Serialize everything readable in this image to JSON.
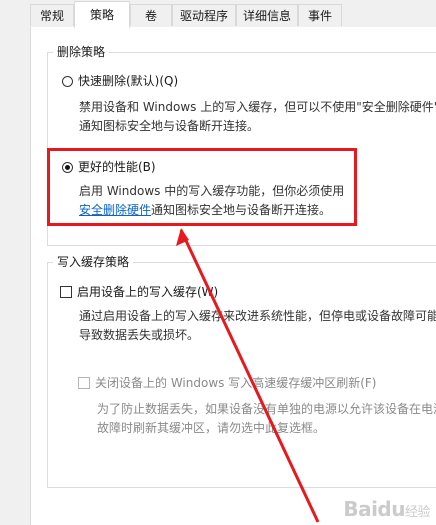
{
  "tabs": [
    {
      "label": "常规",
      "active": false
    },
    {
      "label": "策略",
      "active": true
    },
    {
      "label": "卷",
      "active": false
    },
    {
      "label": "驱动程序",
      "active": false
    },
    {
      "label": "详细信息",
      "active": false
    },
    {
      "label": "事件",
      "active": false
    }
  ],
  "removal_policy": {
    "legend": "删除策略",
    "quick_removal": {
      "label": "快速删除(默认)(Q)",
      "checked": false,
      "desc_line1": "禁用设备和 Windows 上的写入缓存，但可以不使用\"安全删除硬件\"",
      "desc_line2": "通知图标安全地与设备断开连接。"
    },
    "better_performance": {
      "label": "更好的性能(B)",
      "checked": true,
      "desc_line1": "启用 Windows 中的写入缓存功能，但你必须使用",
      "link": "安全删除硬件",
      "desc_line2_rest": "通知图标安全地与设备断开连接。"
    }
  },
  "write_cache_policy": {
    "legend": "写入缓存策略",
    "enable_cache": {
      "label": "启用设备上的写入缓存(W)",
      "checked": false,
      "desc_line1": "通过启用设备上的写入缓存来改进系统性能，但停电或设备故障可能",
      "desc_line2": "导致数据丢失或损坏。"
    },
    "disable_flush": {
      "label": "关闭设备上的 Windows 写入高速缓存缓冲区刷新(F)",
      "checked": false,
      "enabled": false,
      "desc_line1": "为了防止数据丢失，如果设备没有单独的电源以允许该设备在电源",
      "desc_line2": "故障时刷新其缓冲区，请勿选中此复选框。"
    }
  },
  "annotation": {
    "highlight_color": "#e8191e"
  },
  "watermark": {
    "brand": "Baidu",
    "sub": "经验"
  }
}
